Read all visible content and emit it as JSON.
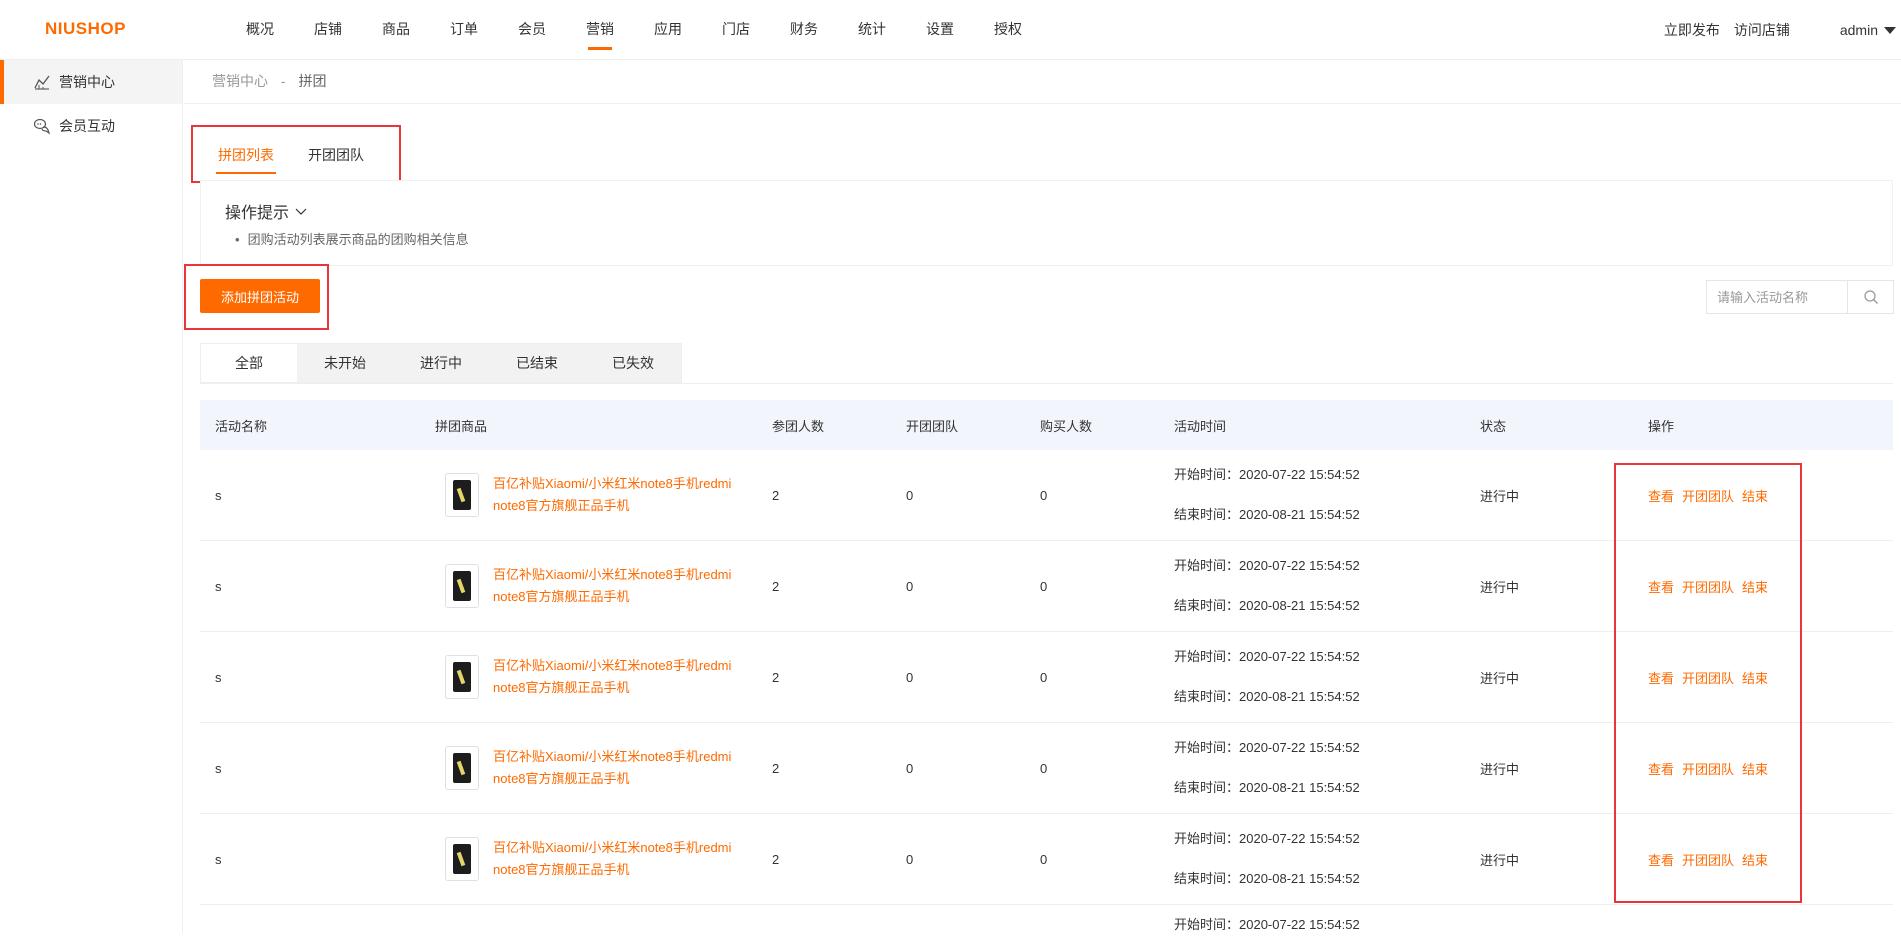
{
  "app": {
    "logo": "NIUSHOP"
  },
  "nav": [
    {
      "label": "概况",
      "active": false
    },
    {
      "label": "店铺",
      "active": false
    },
    {
      "label": "商品",
      "active": false
    },
    {
      "label": "订单",
      "active": false
    },
    {
      "label": "会员",
      "active": false
    },
    {
      "label": "营销",
      "active": true
    },
    {
      "label": "应用",
      "active": false
    },
    {
      "label": "门店",
      "active": false
    },
    {
      "label": "财务",
      "active": false
    },
    {
      "label": "统计",
      "active": false
    },
    {
      "label": "设置",
      "active": false
    },
    {
      "label": "授权",
      "active": false
    }
  ],
  "header": {
    "publish": "立即发布",
    "visit": "访问店铺",
    "user": "admin"
  },
  "sidebar": {
    "items": [
      {
        "label": "营销中心",
        "icon": "chart-line-icon",
        "active": true
      },
      {
        "label": "会员互动",
        "icon": "chat-bubbles-icon",
        "active": false
      }
    ]
  },
  "breadcrumb": {
    "parent": "营销中心",
    "separator": "-",
    "current": "拼团"
  },
  "page_tabs": [
    {
      "label": "拼团列表",
      "active": true
    },
    {
      "label": "开团团队",
      "active": false
    }
  ],
  "tips": {
    "title": "操作提示",
    "line": "团购活动列表展示商品的团购相关信息"
  },
  "toolbar": {
    "add_label": "添加拼团活动",
    "search_placeholder": "请输入活动名称"
  },
  "status_tabs": [
    {
      "label": "全部",
      "active": true
    },
    {
      "label": "未开始",
      "active": false
    },
    {
      "label": "进行中",
      "active": false
    },
    {
      "label": "已结束",
      "active": false
    },
    {
      "label": "已失效",
      "active": false
    }
  ],
  "table": {
    "headers": [
      "活动名称",
      "拼团商品",
      "参团人数",
      "开团团队",
      "购买人数",
      "活动时间",
      "状态",
      "操作"
    ],
    "actions": [
      "查看",
      "开团团队",
      "结束"
    ],
    "rows": [
      {
        "name": "s",
        "goods": "百亿补贴Xiaomi/小米红米note8手机redmi note8官方旗舰正品手机",
        "joined": "2",
        "teams": "0",
        "buyers": "0",
        "start": "开始时间：2020-07-22 15:54:52",
        "end": "结束时间：2020-08-21 15:54:52",
        "status": "进行中"
      },
      {
        "name": "s",
        "goods": "百亿补贴Xiaomi/小米红米note8手机redmi note8官方旗舰正品手机",
        "joined": "2",
        "teams": "0",
        "buyers": "0",
        "start": "开始时间：2020-07-22 15:54:52",
        "end": "结束时间：2020-08-21 15:54:52",
        "status": "进行中"
      },
      {
        "name": "s",
        "goods": "百亿补贴Xiaomi/小米红米note8手机redmi note8官方旗舰正品手机",
        "joined": "2",
        "teams": "0",
        "buyers": "0",
        "start": "开始时间：2020-07-22 15:54:52",
        "end": "结束时间：2020-08-21 15:54:52",
        "status": "进行中"
      },
      {
        "name": "s",
        "goods": "百亿补贴Xiaomi/小米红米note8手机redmi note8官方旗舰正品手机",
        "joined": "2",
        "teams": "0",
        "buyers": "0",
        "start": "开始时间：2020-07-22 15:54:52",
        "end": "结束时间：2020-08-21 15:54:52",
        "status": "进行中"
      },
      {
        "name": "s",
        "goods": "百亿补贴Xiaomi/小米红米note8手机redmi note8官方旗舰正品手机",
        "joined": "2",
        "teams": "0",
        "buyers": "0",
        "start": "开始时间：2020-07-22 15:54:52",
        "end": "结束时间：2020-08-21 15:54:52",
        "status": "进行中"
      }
    ],
    "partial_row_start": "开始时间：2020-07-22 15:54:52"
  },
  "colors": {
    "accent": "#ff6a00",
    "highlight_box": "#e8363b",
    "table_header_bg": "#f2f5fc"
  }
}
